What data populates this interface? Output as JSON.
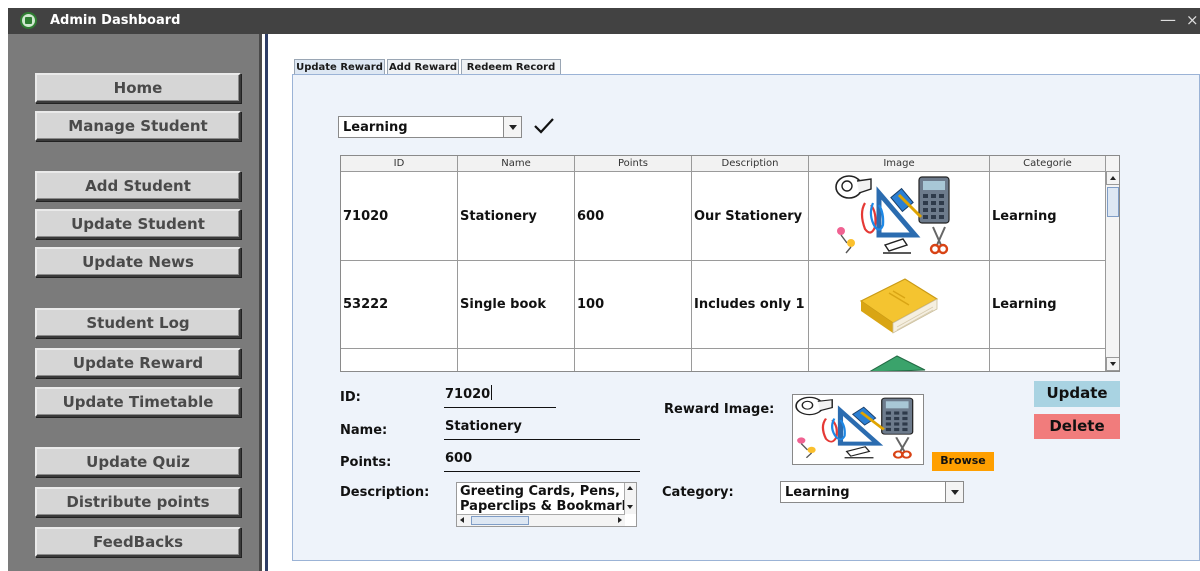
{
  "window": {
    "title": "Admin Dashboard",
    "minimize_glyph": "—",
    "close_glyph": "×",
    "icon": "app-logo-icon"
  },
  "sidebar": {
    "items": [
      {
        "label": "Home"
      },
      {
        "label": "Manage Student"
      },
      {
        "label": "Add Student"
      },
      {
        "label": "Update Student"
      },
      {
        "label": "Update News"
      },
      {
        "label": "Student Log"
      },
      {
        "label": "Update Reward"
      },
      {
        "label": "Update Timetable"
      },
      {
        "label": "Update Quiz"
      },
      {
        "label": "Distribute points"
      },
      {
        "label": "FeedBacks"
      }
    ]
  },
  "tabs": [
    {
      "label": "Update Reward",
      "active": true
    },
    {
      "label": "Add Reward",
      "active": false
    },
    {
      "label": "Redeem Record",
      "active": false
    }
  ],
  "filter": {
    "category_value": "Learning",
    "confirm_icon": "checkmark-icon"
  },
  "table": {
    "columns": [
      "ID",
      "Name",
      "Points",
      "Description",
      "Image",
      "Categorie"
    ],
    "rows": [
      {
        "id": "71020",
        "name": "Stationery",
        "points": "600",
        "description": "Our Stationery ...",
        "image": "stationery-image",
        "category": "Learning"
      },
      {
        "id": "53222",
        "name": "Single book",
        "points": "100",
        "description": "Includes only 1 ...",
        "image": "book-image",
        "category": "Learning"
      },
      {
        "id": "",
        "name": "",
        "points": "",
        "description": "",
        "image": "book-image",
        "category": ""
      }
    ]
  },
  "form": {
    "id_label": "ID:",
    "id_value": "71020",
    "name_label": "Name:",
    "name_value": "Stationery",
    "points_label": "Points:",
    "points_value": "600",
    "description_label": "Description:",
    "description_lines": [
      "Greeting Cards, Pens, Pen",
      "Paperclips & Bookmarks"
    ],
    "reward_image_label": "Reward Image:",
    "category_label": "Category:",
    "category_value": "Learning",
    "browse_label": "Browse"
  },
  "actions": {
    "update_label": "Update",
    "delete_label": "Delete"
  },
  "colors": {
    "titlebar": "#424242",
    "sidebar": "#7b7b7b",
    "panel": "#eef3fa",
    "update_button": "#a9d3e2",
    "delete_button": "#f17c7c",
    "browse_button": "#ff9f00"
  }
}
